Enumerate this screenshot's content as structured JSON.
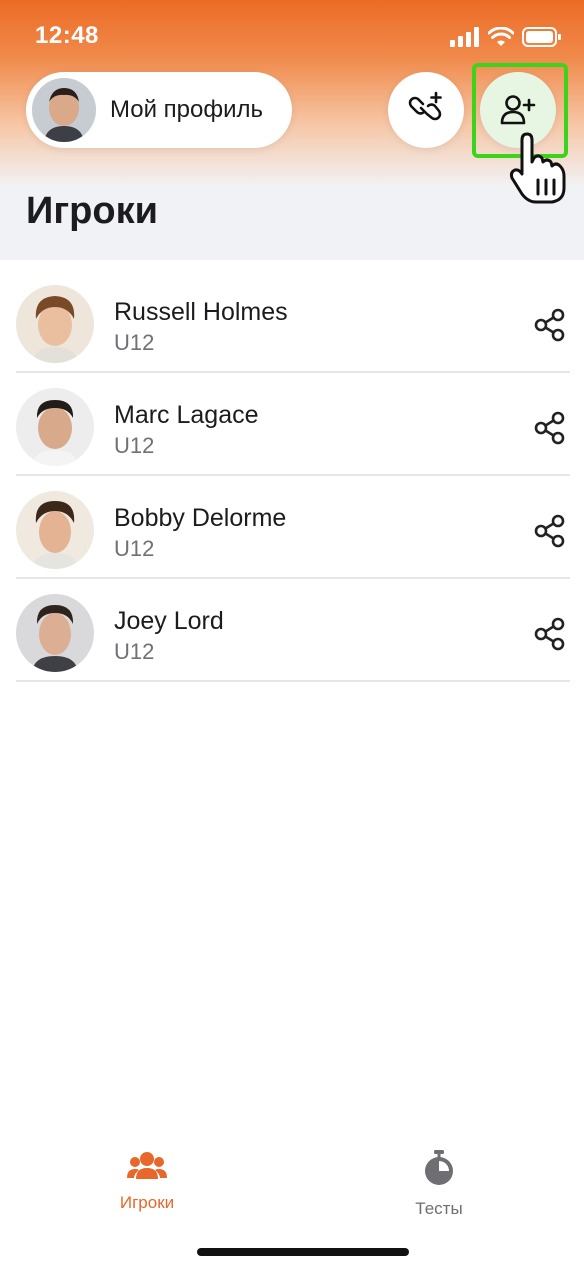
{
  "status_bar": {
    "time": "12:48"
  },
  "header": {
    "profile_label": "Мой профиль",
    "link_player_icon": "link-plus-icon",
    "add_player_icon": "user-plus-icon"
  },
  "page": {
    "title": "Игроки"
  },
  "players": [
    {
      "name": "Russell Holmes",
      "team": "U12"
    },
    {
      "name": "Marc Lagace",
      "team": "U12"
    },
    {
      "name": "Bobby Delorme",
      "team": "U12"
    },
    {
      "name": "Joey Lord",
      "team": "U12"
    }
  ],
  "tabbar": {
    "tabs": [
      {
        "label": "Игроки",
        "icon": "group-icon",
        "active": true
      },
      {
        "label": "Тесты",
        "icon": "stopwatch-icon",
        "active": false
      }
    ]
  },
  "colors": {
    "accent": "#e8672a",
    "highlight": "#3cd31b",
    "inactive": "#6e6e73"
  }
}
